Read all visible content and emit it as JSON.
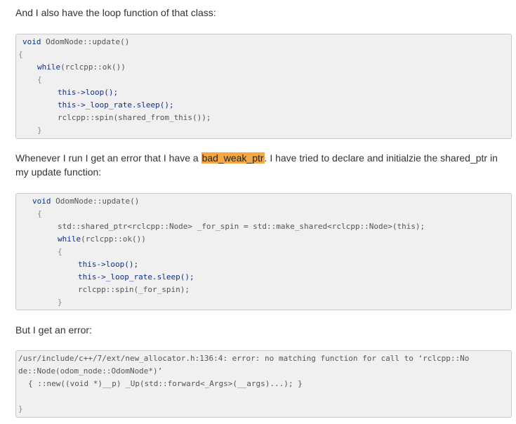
{
  "paragraphs": {
    "p1": "And I also have the loop function of that class:",
    "p2_before": "Whenever I run I get an error that I have a ",
    "p2_highlight": "bad_weak_ptr",
    "p2_after": ". I have tried to declare and initialzie the shared_ptr in my update function:",
    "p3": "But I get an error:"
  },
  "code1": {
    "l1a": "void",
    "l1b": " OdomNode::update()",
    "l2": "{",
    "l3a": "while",
    "l3b": "(rclcpp::ok())",
    "l4": "{",
    "l5": "this->loop();",
    "l6": "this->_loop_rate.sleep();",
    "l7": "rclcpp::spin(shared_from_this());",
    "l8": "}"
  },
  "code2": {
    "l1a": "void",
    "l1b": " OdomNode::update()",
    "l2": "{",
    "l3": "std::shared_ptr<rclcpp::Node> _for_spin = std::make_shared<rclcpp::Node>(this);",
    "l4a": "while",
    "l4b": "(rclcpp::ok())",
    "l5": "{",
    "l6": "this->loop();",
    "l7": "this->_loop_rate.sleep();",
    "l8": "rclcpp::spin(_for_spin);",
    "l9": "}"
  },
  "code3": {
    "l1": "/usr/include/c++/7/ext/new_allocator.h:136:4: error: no matching function for call to ‘rclcpp::No",
    "l2": "de::Node(odom_node::OdomNode*)’",
    "l3": "{ ::new((void *)__p) _Up(std::forward<_Args>(__args)...); }",
    "l4": "}"
  },
  "colors": {
    "highlight": "#f5a742",
    "code_background": "#f0f0f0",
    "keyword": "#0a2f8c"
  }
}
